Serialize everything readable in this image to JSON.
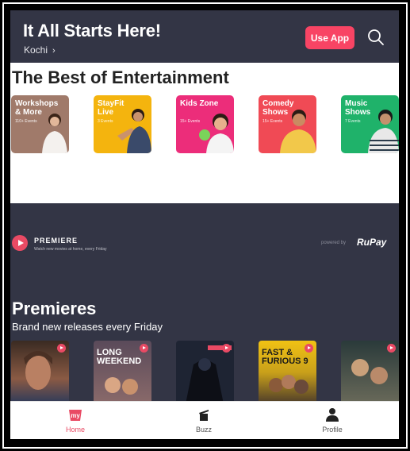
{
  "header": {
    "title": "It All Starts Here!",
    "city": "Kochi",
    "use_app_label": "Use App",
    "search_icon": "search-icon"
  },
  "entertainment": {
    "title": "The Best of Entertainment",
    "cards": [
      {
        "title": "Workshops & More",
        "subtitle": "110+ Events",
        "color": "#a07a6a"
      },
      {
        "title": "StayFit Live",
        "subtitle": "3 Events",
        "color": "#f4b40e"
      },
      {
        "title": "Kids Zone",
        "subtitle": "15+ Events",
        "color": "#ec2d7a"
      },
      {
        "title": "Comedy Shows",
        "subtitle": "15+ Events",
        "color": "#f04a55"
      },
      {
        "title": "Music Shows",
        "subtitle": "7 Events",
        "color": "#1fb26a"
      }
    ]
  },
  "banner": {
    "brand": "PREMIERE",
    "tagline": "Watch new movies at home, every Friday",
    "powered_by": "powered by",
    "partner": "RuPay"
  },
  "premieres": {
    "title": "Premieres",
    "subtitle": "Brand new releases every Friday",
    "posters": [
      {
        "text": "",
        "color": "#6a4a3a"
      },
      {
        "text": "LONG WEEKEND",
        "color": "#7a5a6a"
      },
      {
        "text": "",
        "color": "#1e2433"
      },
      {
        "text": "FAST & FURIOUS 9",
        "color": "#f1c214"
      },
      {
        "text": "",
        "color": "#3b4a4a"
      }
    ]
  },
  "bottom_nav": [
    {
      "label": "Home",
      "icon": "home-icon",
      "active": true
    },
    {
      "label": "Buzz",
      "icon": "buzz-icon",
      "active": false
    },
    {
      "label": "Profile",
      "icon": "profile-icon",
      "active": false
    }
  ],
  "colors": {
    "accent": "#f84464",
    "header_bg": "#333545"
  }
}
